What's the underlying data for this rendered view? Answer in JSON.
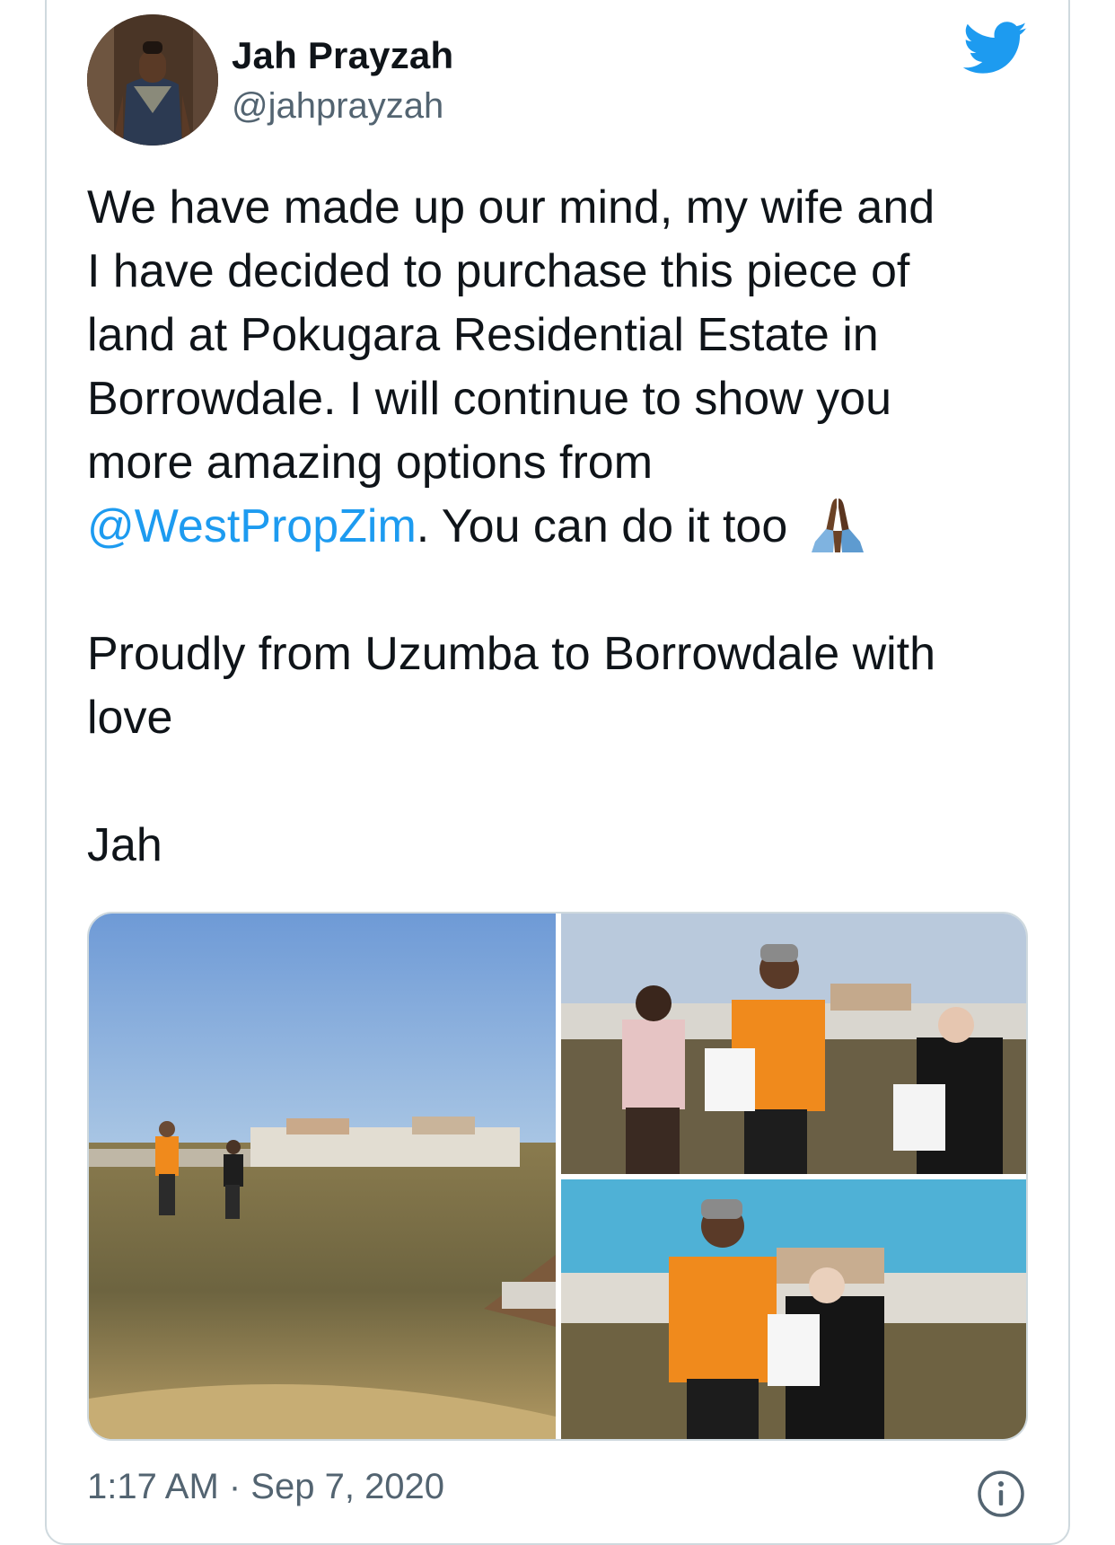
{
  "tweet": {
    "author": {
      "display_name": "Jah Prayzah",
      "handle": "@jahprayzah",
      "avatar_icon": "profile-photo"
    },
    "text_lines": {
      "l1": "We have made up our mind, my wife and",
      "l2": "I have decided to purchase this piece of",
      "l3": "land at Pokugara Residential Estate in",
      "l4": "Borrowdale. I will continue to show you",
      "l5": "more amazing options from",
      "mention": "@WestPropZim",
      "l6_after_mention": ". You can do it too",
      "emoji": "folded-hands-icon",
      "p2_l1": "Proudly from Uzumba to Borrowdale with",
      "p2_l2": "love",
      "p3": "Jah"
    },
    "media": {
      "count": 3,
      "photos": [
        "land-walk-photo",
        "handover-group-photo",
        "handover-pair-photo"
      ]
    },
    "timestamp": "1:17 AM · Sep 7, 2020",
    "icons": {
      "brand": "twitter-bird-icon",
      "info": "info-icon"
    },
    "colors": {
      "link": "#1d9bf0",
      "secondary_text": "#536471",
      "border": "#cfd9de",
      "brand": "#1d9bf0"
    }
  }
}
